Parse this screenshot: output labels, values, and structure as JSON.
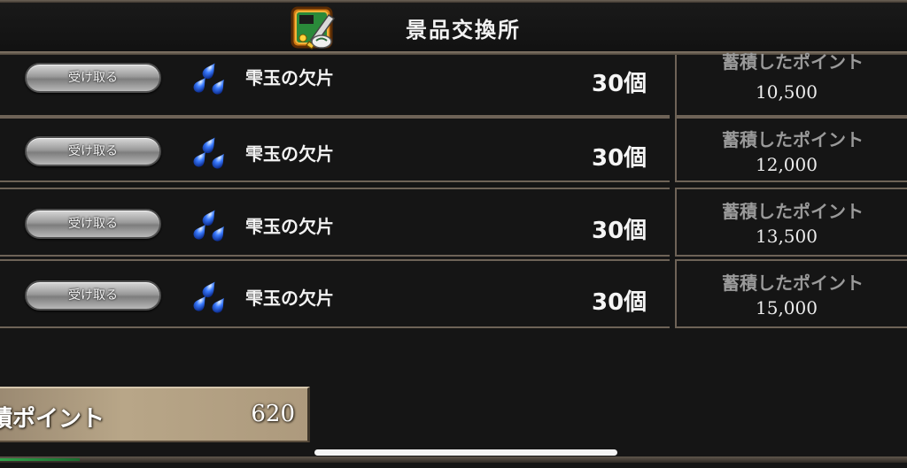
{
  "header": {
    "title": "景品交換所",
    "icon": "shop-exchange-icon"
  },
  "rewards": [
    {
      "claim_label": "受け取る",
      "item_icon": "water-drops-icon",
      "item_name": "雫玉の欠片",
      "quantity": "30個",
      "points_label": "蓄積したポイント",
      "points_value": "10,500"
    },
    {
      "claim_label": "受け取る",
      "item_icon": "water-drops-icon",
      "item_name": "雫玉の欠片",
      "quantity": "30個",
      "points_label": "蓄積したポイント",
      "points_value": "12,000"
    },
    {
      "claim_label": "受け取る",
      "item_icon": "water-drops-icon",
      "item_name": "雫玉の欠片",
      "quantity": "30個",
      "points_label": "蓄積したポイント",
      "points_value": "13,500"
    },
    {
      "claim_label": "受け取る",
      "item_icon": "water-drops-icon",
      "item_name": "雫玉の欠片",
      "quantity": "30個",
      "points_label": "蓄積したポイント",
      "points_value": "15,000"
    }
  ],
  "total": {
    "label": "積ポイント",
    "value": "620"
  },
  "colors": {
    "background": "#151515",
    "frame": "#6e6357",
    "total_panel": "#b8a688",
    "drop_blue": "#3a7bff"
  }
}
